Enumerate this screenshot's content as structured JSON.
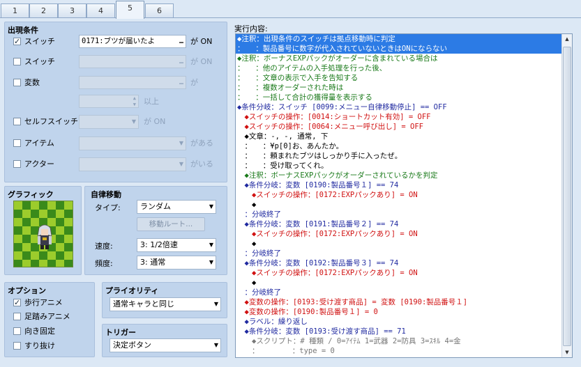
{
  "tabs": [
    "1",
    "2",
    "3",
    "4",
    "5",
    "6"
  ],
  "conditions": {
    "title": "出現条件",
    "switch1": {
      "label": "スイッチ",
      "value": "0171:ブツが届いたよ",
      "suffix": "が ON",
      "checked": true
    },
    "switch2": {
      "label": "スイッチ",
      "value": "",
      "suffix": "が ON",
      "checked": false
    },
    "variable": {
      "label": "変数",
      "value": "",
      "suffix": "が",
      "checked": false,
      "above": "以上"
    },
    "selfswitch": {
      "label": "セルフスイッチ",
      "value": "",
      "suffix": "が ON",
      "checked": false
    },
    "item": {
      "label": "アイテム",
      "value": "",
      "suffix": "がある",
      "checked": false
    },
    "actor": {
      "label": "アクター",
      "value": "",
      "suffix": "がいる",
      "checked": false
    },
    "more_button": "…"
  },
  "graphic": {
    "title": "グラフィック"
  },
  "autonomous": {
    "title": "自律移動",
    "type_label": "タイプ:",
    "type_value": "ランダム",
    "route_button": "移動ルート...",
    "speed_label": "速度:",
    "speed_value": "3: 1/2倍速",
    "freq_label": "頻度:",
    "freq_value": "3: 通常"
  },
  "options": {
    "title": "オプション",
    "items": [
      {
        "label": "歩行アニメ",
        "checked": true
      },
      {
        "label": "足踏みアニメ",
        "checked": false
      },
      {
        "label": "向き固定",
        "checked": false
      },
      {
        "label": "すり抜け",
        "checked": false
      }
    ]
  },
  "priority": {
    "title": "プライオリティ",
    "value": "通常キャラと同じ"
  },
  "trigger": {
    "title": "トリガー",
    "value": "決定ボタン"
  },
  "contents": {
    "title": "実行内容:",
    "lines": [
      {
        "t": "◆注釈：出現条件のスイッチは拠点移動時に判定",
        "c": "c-green",
        "sel": true
      },
      {
        "t": "：　　：製品番号に数字が代入されていないときはONにならない",
        "c": "c-green",
        "sel": true
      },
      {
        "t": "◆注釈：ボーナスEXPパックがオーダーに含まれている場合は",
        "c": "c-green"
      },
      {
        "t": "：　　：他のアイテムの入手処理を行った後、",
        "c": "c-green"
      },
      {
        "t": "：　　：文章の表示で入手を告知する",
        "c": "c-green"
      },
      {
        "t": "：　　：複数オーダーされた時は",
        "c": "c-green"
      },
      {
        "t": "：　　：一括して合計の獲得量を表示する",
        "c": "c-green"
      },
      {
        "t": "◆条件分岐：スイッチ [0099:メニュー自律移動停止] == OFF",
        "c": "c-blue"
      },
      {
        "t": "　◆スイッチの操作：[0014:ショートカット有効] = OFF",
        "c": "c-red"
      },
      {
        "t": "　◆スイッチの操作：[0064:メニュー呼び出し] = OFF",
        "c": "c-red"
      },
      {
        "t": "　◆文章：-, -, 通常, 下",
        "c": "c-black"
      },
      {
        "t": "　：　　：¥p[0]お、あんたか。",
        "c": "c-black"
      },
      {
        "t": "　：　　：頼まれたブツはしっかり手に入ったぜ。",
        "c": "c-black"
      },
      {
        "t": "　：　　：受け取ってくれ。",
        "c": "c-black"
      },
      {
        "t": "　◆注釈：ボーナスEXPパックがオーダーされているかを判定",
        "c": "c-green"
      },
      {
        "t": "　◆条件分岐：変数 [0190:製品番号１] == 74",
        "c": "c-blue"
      },
      {
        "t": "　　◆スイッチの操作：[0172:EXPパックあり] = ON",
        "c": "c-red"
      },
      {
        "t": "　　◆",
        "c": "c-black"
      },
      {
        "t": "　：分岐終了",
        "c": "c-blue"
      },
      {
        "t": "　◆条件分岐：変数 [0191:製品番号２] == 74",
        "c": "c-blue"
      },
      {
        "t": "　　◆スイッチの操作：[0172:EXPパックあり] = ON",
        "c": "c-red"
      },
      {
        "t": "　　◆",
        "c": "c-black"
      },
      {
        "t": "　：分岐終了",
        "c": "c-blue"
      },
      {
        "t": "　◆条件分岐：変数 [0192:製品番号３] == 74",
        "c": "c-blue"
      },
      {
        "t": "　　◆スイッチの操作：[0172:EXPパックあり] = ON",
        "c": "c-red"
      },
      {
        "t": "　　◆",
        "c": "c-black"
      },
      {
        "t": "　：分岐終了",
        "c": "c-blue"
      },
      {
        "t": "　◆変数の操作：[0193:受け渡す商品] = 変数 [0190:製品番号１]",
        "c": "c-red"
      },
      {
        "t": "　◆変数の操作：[0190:製品番号１] = 0",
        "c": "c-red"
      },
      {
        "t": "　◆ラベル：繰り返し",
        "c": "c-blue"
      },
      {
        "t": "　◆条件分岐：変数 [0193:受け渡す商品] == 71",
        "c": "c-blue"
      },
      {
        "t": "　　◆スクリプト：# 種類 / 0=ｱｲﾃﾑ 1=武器 2=防具 3=ｽｷﾙ 4=金",
        "c": "c-gray"
      },
      {
        "t": "　　：　　　　　：type = 0",
        "c": "c-gray"
      }
    ]
  }
}
